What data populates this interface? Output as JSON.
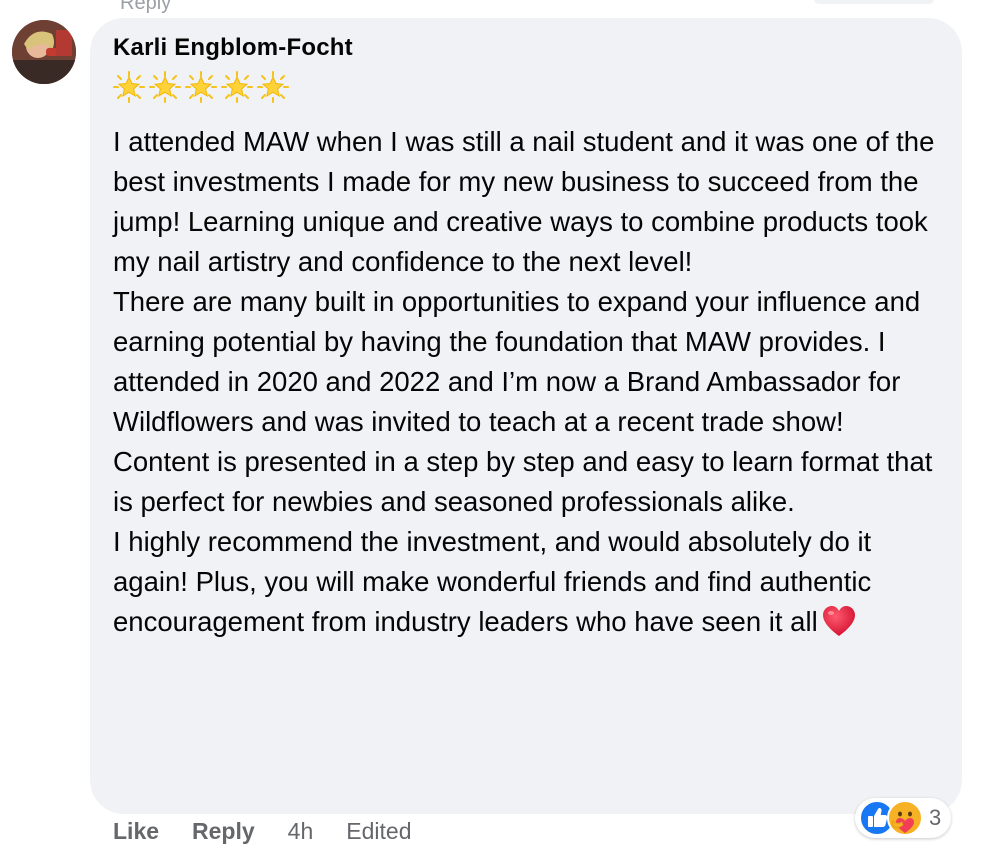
{
  "comment": {
    "author": "Karli Engblom-Focht",
    "rating_stars": 5,
    "paragraphs": [
      "I attended MAW when I was still a nail student and it was one of the best investments I made for my new business to succeed from the jump! Learning unique and creative ways to combine products took my nail artistry and confidence to the next level!",
      "There are many built in opportunities to expand your influence and earning potential by having the foundation that MAW provides. I attended in 2020 and 2022 and I’m now a Brand Ambassador for Wildflowers and was invited to teach at a recent trade show!",
      "Content is presented in a step by step and easy to learn format that is perfect for newbies and seasoned professionals alike.",
      "I highly recommend the investment, and would absolutely do it again! Plus, you will make wonderful friends and find authentic encouragement from industry leaders who have seen it all"
    ],
    "reactions": {
      "icons": [
        "like-icon",
        "care-icon"
      ],
      "count": "3"
    },
    "actions": {
      "like": "Like",
      "reply": "Reply",
      "time": "4h",
      "edited": "Edited"
    }
  },
  "previous_comment": {
    "reply_partial": "Reply"
  },
  "colors": {
    "bubble": "#f0f2f5",
    "like_blue": "#1877f2",
    "muted_text": "#65676b",
    "heart_red": "#e0245e"
  }
}
